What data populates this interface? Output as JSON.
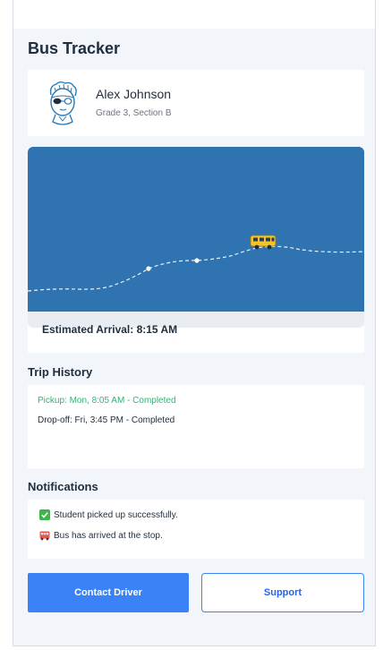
{
  "header": {
    "title": "Bus Tracker"
  },
  "student": {
    "name": "Alex Johnson",
    "class": "Grade 3, Section B",
    "avatar_icon": "student-avatar-icon"
  },
  "map": {
    "background_color": "#2f74b0",
    "bus_icon": "school-bus-icon",
    "eta_text": "Estimated Arrival: 8:15 AM"
  },
  "trip_history": {
    "heading": "Trip History",
    "entries": [
      {
        "text": "Pickup: Mon, 8:05 AM - Completed",
        "status": "completed",
        "color": "#2bb673"
      },
      {
        "text": "Drop-off: Fri, 3:45 PM - Completed",
        "status": "completed",
        "color": "#1f2d3d"
      }
    ]
  },
  "notifications": {
    "heading": "Notifications",
    "items": [
      {
        "icon": "check-mark-icon",
        "text": "Student picked up successfully."
      },
      {
        "icon": "bus-icon",
        "text": "Bus has arrived at the stop."
      }
    ]
  },
  "actions": {
    "contact_driver": "Contact Driver",
    "support": "Support"
  },
  "colors": {
    "primary": "#3b82f6",
    "success": "#2bb673",
    "map": "#2f74b0"
  }
}
